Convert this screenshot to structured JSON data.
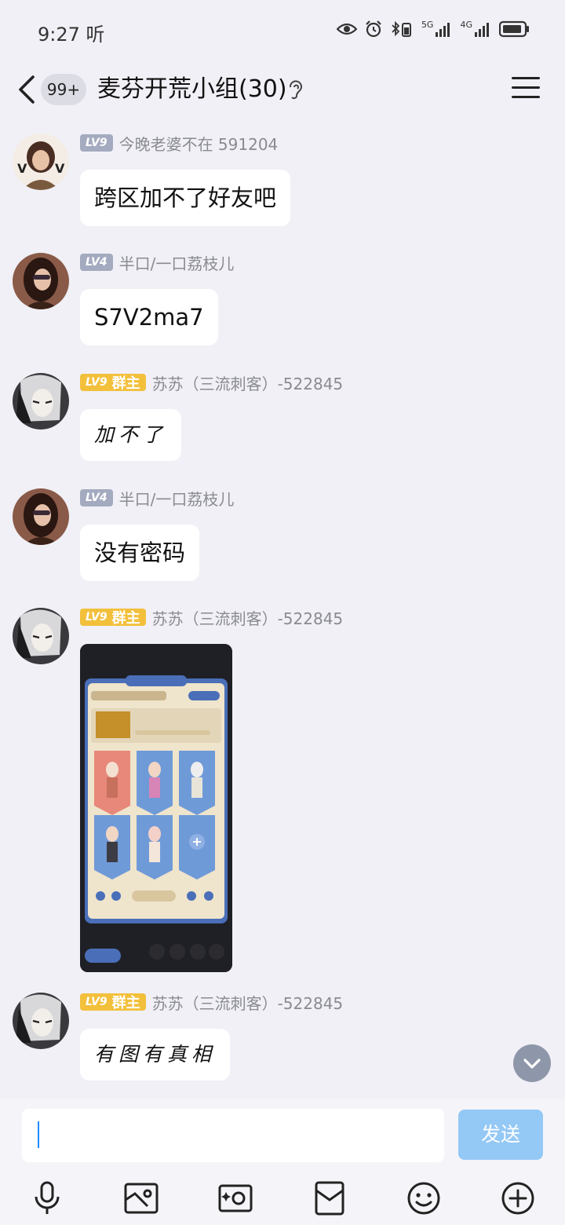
{
  "status_bar": {
    "time": "9:27 听",
    "network_1": "5G",
    "network_2": "4G"
  },
  "header": {
    "unread_badge": "99+",
    "title": "麦芬开荒小组(30)"
  },
  "messages": [
    {
      "level": "LV9",
      "role": "",
      "sender": "今晚老婆不在 591204",
      "text": "跨区加不了好友吧"
    },
    {
      "level": "LV4",
      "role": "",
      "sender": "半口/一口荔枝儿",
      "text": "S7V2ma7"
    },
    {
      "level": "LV9",
      "role": "群主",
      "sender": "苏苏（三流刺客）-522845",
      "text": "加不了"
    },
    {
      "level": "LV4",
      "role": "",
      "sender": "半口/一口荔枝儿",
      "text": "没有密码"
    },
    {
      "level": "LV9",
      "role": "群主",
      "sender": "苏苏（三流刺客）-522845",
      "text": ""
    },
    {
      "level": "LV9",
      "role": "群主",
      "sender": "苏苏（三流刺客）-522845",
      "text": "有图有真相"
    }
  ],
  "input": {
    "value": "",
    "send_label": "发送"
  },
  "toolbar_icons": [
    "microphone-icon",
    "image-icon",
    "camera-icon",
    "red-packet-icon",
    "emoji-icon",
    "plus-icon"
  ],
  "colors": {
    "background": "#f0f0f6",
    "owner_badge": "#f3c03c",
    "level_badge": "#a4abc0",
    "send_button": "#94c8f5",
    "caret": "#1e8cff"
  }
}
